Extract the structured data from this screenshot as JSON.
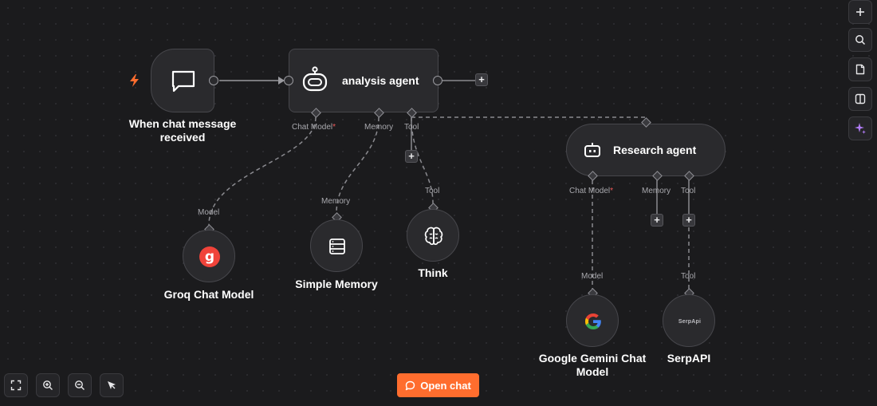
{
  "canvas": {
    "trigger": {
      "title": "When chat message received",
      "line1": "When chat message",
      "line2": "received"
    },
    "analysis_agent": {
      "title": "analysis agent",
      "ports": {
        "chat_model": "Chat Model",
        "memory": "Memory",
        "tool": "Tool",
        "required_mark": "*"
      }
    },
    "research_agent": {
      "title": "Research agent",
      "ports": {
        "chat_model": "Chat Model",
        "memory": "Memory",
        "tool": "Tool",
        "required_mark": "*"
      }
    },
    "groq": {
      "title": "Groq Chat Model",
      "port": "Model",
      "logo_letter": "g"
    },
    "simple_memory": {
      "title": "Simple Memory",
      "port": "Memory"
    },
    "think": {
      "title": "Think",
      "port": "Tool"
    },
    "gemini": {
      "title": "Google Gemini Chat Model",
      "line1": "Google Gemini Chat",
      "line2": "Model",
      "port": "Model"
    },
    "serpapi": {
      "title": "SerpAPI",
      "port": "Tool",
      "logo_text": "SerpApi"
    },
    "add_glyph": "+"
  },
  "right_toolbar": {
    "items": [
      {
        "name": "add-node",
        "icon": "plus-icon"
      },
      {
        "name": "search",
        "icon": "search-icon"
      },
      {
        "name": "sticky-note",
        "icon": "note-icon"
      },
      {
        "name": "toggle-panel",
        "icon": "panel-icon"
      },
      {
        "name": "ai-assistant",
        "icon": "sparkle-icon"
      }
    ]
  },
  "bottom_toolbar": {
    "items": [
      {
        "name": "fit-view",
        "icon": "fit-view-icon"
      },
      {
        "name": "zoom-in",
        "icon": "zoom-in-icon"
      },
      {
        "name": "zoom-out",
        "icon": "zoom-out-icon"
      },
      {
        "name": "tidy-up",
        "icon": "pointer-icon"
      }
    ],
    "open_chat_label": "Open chat"
  },
  "colors": {
    "accent": "#ff6d2e",
    "trigger_bolt": "#ff6d2e",
    "groq_red": "#f0433a",
    "sparkle": "#b07cf5",
    "required": "#f05a5a"
  }
}
